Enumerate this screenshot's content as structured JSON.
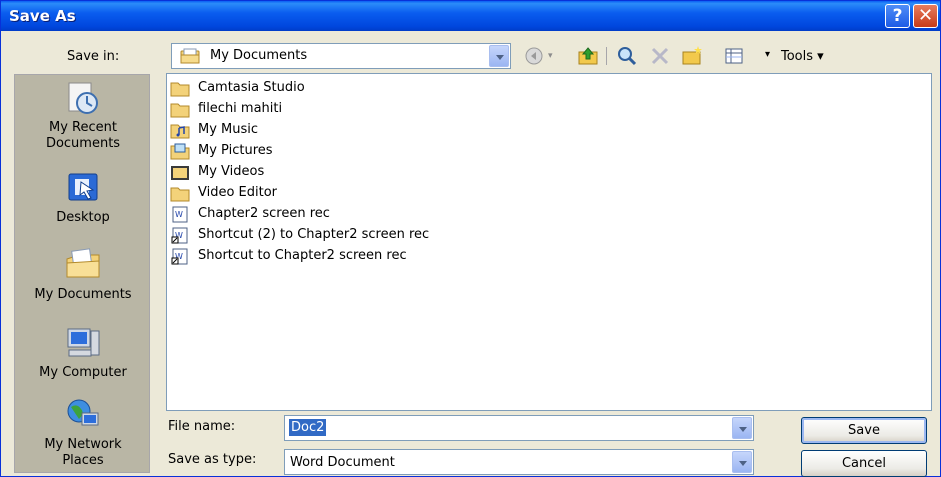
{
  "window": {
    "title": "Save As"
  },
  "titlebar": {
    "help_glyph": "?",
    "close_glyph": "✕"
  },
  "toolbar": {
    "save_in_label": "Save in:",
    "save_in_value": "My Documents",
    "tools_label": "Tools ▾",
    "icons": [
      "back-icon",
      "up-folder-icon",
      "search-web-icon",
      "delete-icon",
      "new-folder-icon",
      "views-icon"
    ]
  },
  "places": [
    {
      "label": "My Recent Documents",
      "icon": "recent-documents-icon"
    },
    {
      "label": "Desktop",
      "icon": "desktop-icon"
    },
    {
      "label": "My Documents",
      "icon": "my-documents-icon"
    },
    {
      "label": "My Computer",
      "icon": "my-computer-icon"
    },
    {
      "label": "My Network Places",
      "icon": "network-places-icon"
    }
  ],
  "files": [
    {
      "name": "Camtasia Studio",
      "type": "folder"
    },
    {
      "name": "filechi mahiti",
      "type": "folder"
    },
    {
      "name": "My Music",
      "type": "music-folder"
    },
    {
      "name": "My Pictures",
      "type": "pictures-folder"
    },
    {
      "name": "My Videos",
      "type": "videos-folder"
    },
    {
      "name": "Video Editor",
      "type": "folder"
    },
    {
      "name": "Chapter2 screen rec",
      "type": "word-doc"
    },
    {
      "name": "Shortcut (2) to Chapter2 screen rec",
      "type": "shortcut"
    },
    {
      "name": "Shortcut to Chapter2 screen rec",
      "type": "shortcut"
    }
  ],
  "form": {
    "file_name_label": "File name:",
    "file_name_value": "Doc2",
    "save_as_type_label": "Save as type:",
    "save_as_type_value": "Word Document"
  },
  "buttons": {
    "save": "Save",
    "cancel": "Cancel"
  },
  "colors": {
    "title_bar": "#0A5DEF",
    "dialog_bg": "#ECE9D8",
    "places_bg": "#B9B6A5",
    "selection": "#316AC5"
  }
}
